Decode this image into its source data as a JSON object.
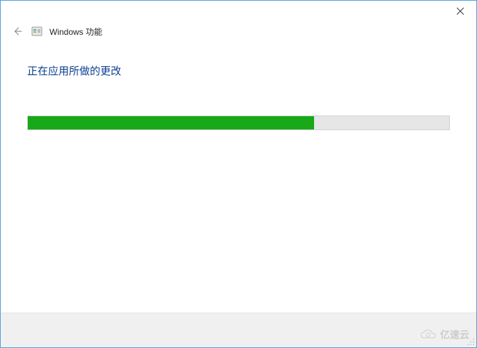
{
  "window": {
    "title": "Windows 功能"
  },
  "content": {
    "status_heading": "正在应用所做的更改"
  },
  "progress": {
    "percent": 68,
    "fill_color": "#18a818",
    "track_color": "#e6e6e6"
  },
  "watermark": {
    "text": "亿速云"
  }
}
